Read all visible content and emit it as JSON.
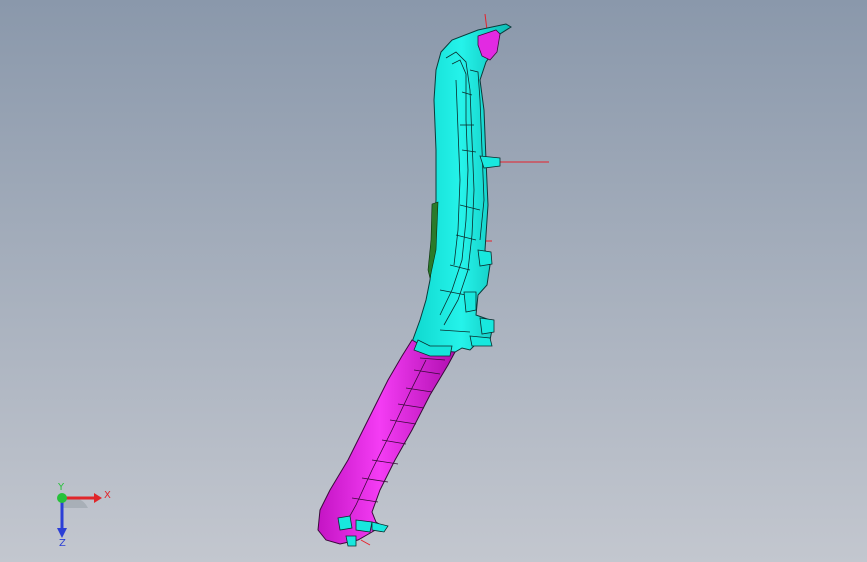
{
  "viewport": {
    "background_top": "#8a98ab",
    "background_bottom": "#bfc4cd"
  },
  "part": {
    "upper_color": "#13e6dc",
    "lower_color": "#ee22ee",
    "edge_color": "#0a2a2a",
    "reference_line_color": "#e8202a"
  },
  "triad": {
    "x_label": "X",
    "y_label": "Y",
    "z_label": "Z",
    "x_color": "#e0262a",
    "y_color": "#27c13a",
    "z_color": "#2b3fd6"
  }
}
